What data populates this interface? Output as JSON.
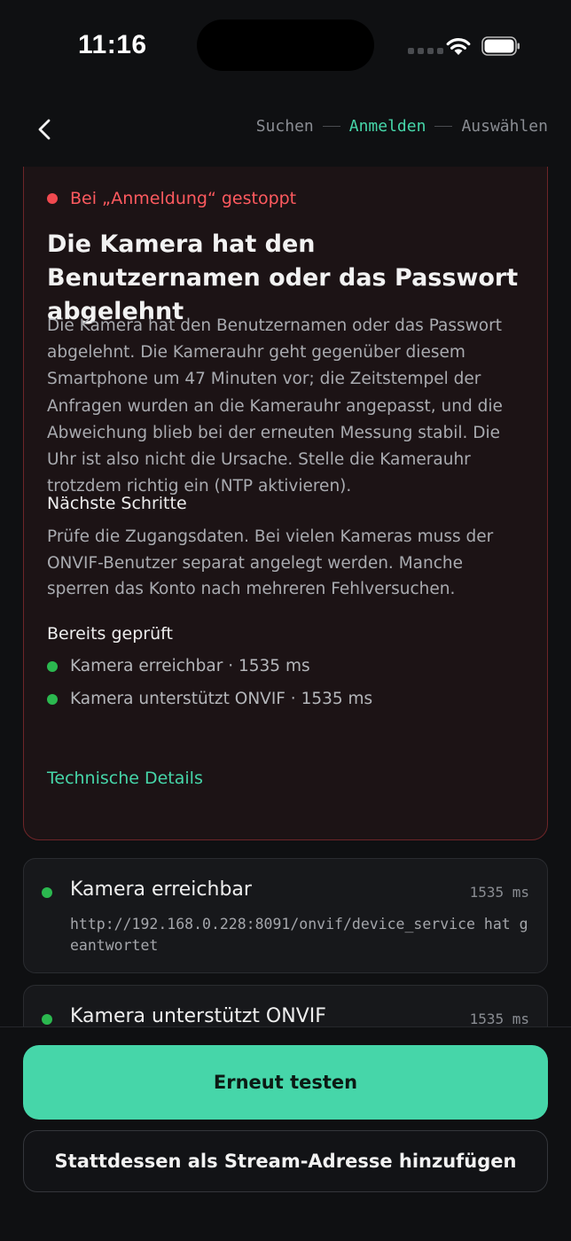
{
  "status_bar": {
    "time": "11:16"
  },
  "nav": {
    "steps": [
      {
        "label": "Suchen",
        "active": false
      },
      {
        "label": "Anmelden",
        "active": true
      },
      {
        "label": "Auswählen",
        "active": false
      }
    ]
  },
  "error": {
    "stopped_at": "Bei „Anmeldung“ gestoppt",
    "title": "Die Kamera hat den Benutzernamen oder das Passwort abgelehnt",
    "body": "Die Kamera hat den Benutzernamen oder das Passwort abgelehnt. Die Kamerauhr geht gegenüber diesem Smartphone um 47 Minuten vor; die Zeitstempel der Anfragen wurden an die Kamerauhr angepasst, und die Abweichung blieb bei der erneuten Messung stabil. Die Uhr ist also nicht die Ursache. Stelle die Kamerauhr trotzdem richtig ein (NTP aktivieren).",
    "next_steps_heading": "Nächste Schritte",
    "next_steps_body": "Prüfe die Zugangsdaten. Bei vielen Kameras muss der ONVIF-Benutzer separat angelegt werden. Manche sperren das Konto nach mehreren Fehlversuchen.",
    "checked_heading": "Bereits geprüft",
    "checked_items": [
      "Kamera erreichbar · 1535 ms",
      "Kamera unterstützt ONVIF · 1535 ms"
    ],
    "details_link": "Technische Details"
  },
  "steps_list": [
    {
      "title": "Kamera erreichbar",
      "duration": "1535 ms",
      "detail": "http://192.168.0.228:8091/onvif/device_service hat geantwortet"
    },
    {
      "title": "Kamera unterstützt ONVIF",
      "duration": "1535 ms",
      "detail": ""
    }
  ],
  "actions": {
    "retry_label": "Erneut testen",
    "add_stream_label": "Stattdessen als Stream-Adresse hinzufügen"
  },
  "colors": {
    "accent": "#46d6a9",
    "error": "#ff5a5f",
    "success": "#2bb84f",
    "background": "#0f1012"
  }
}
